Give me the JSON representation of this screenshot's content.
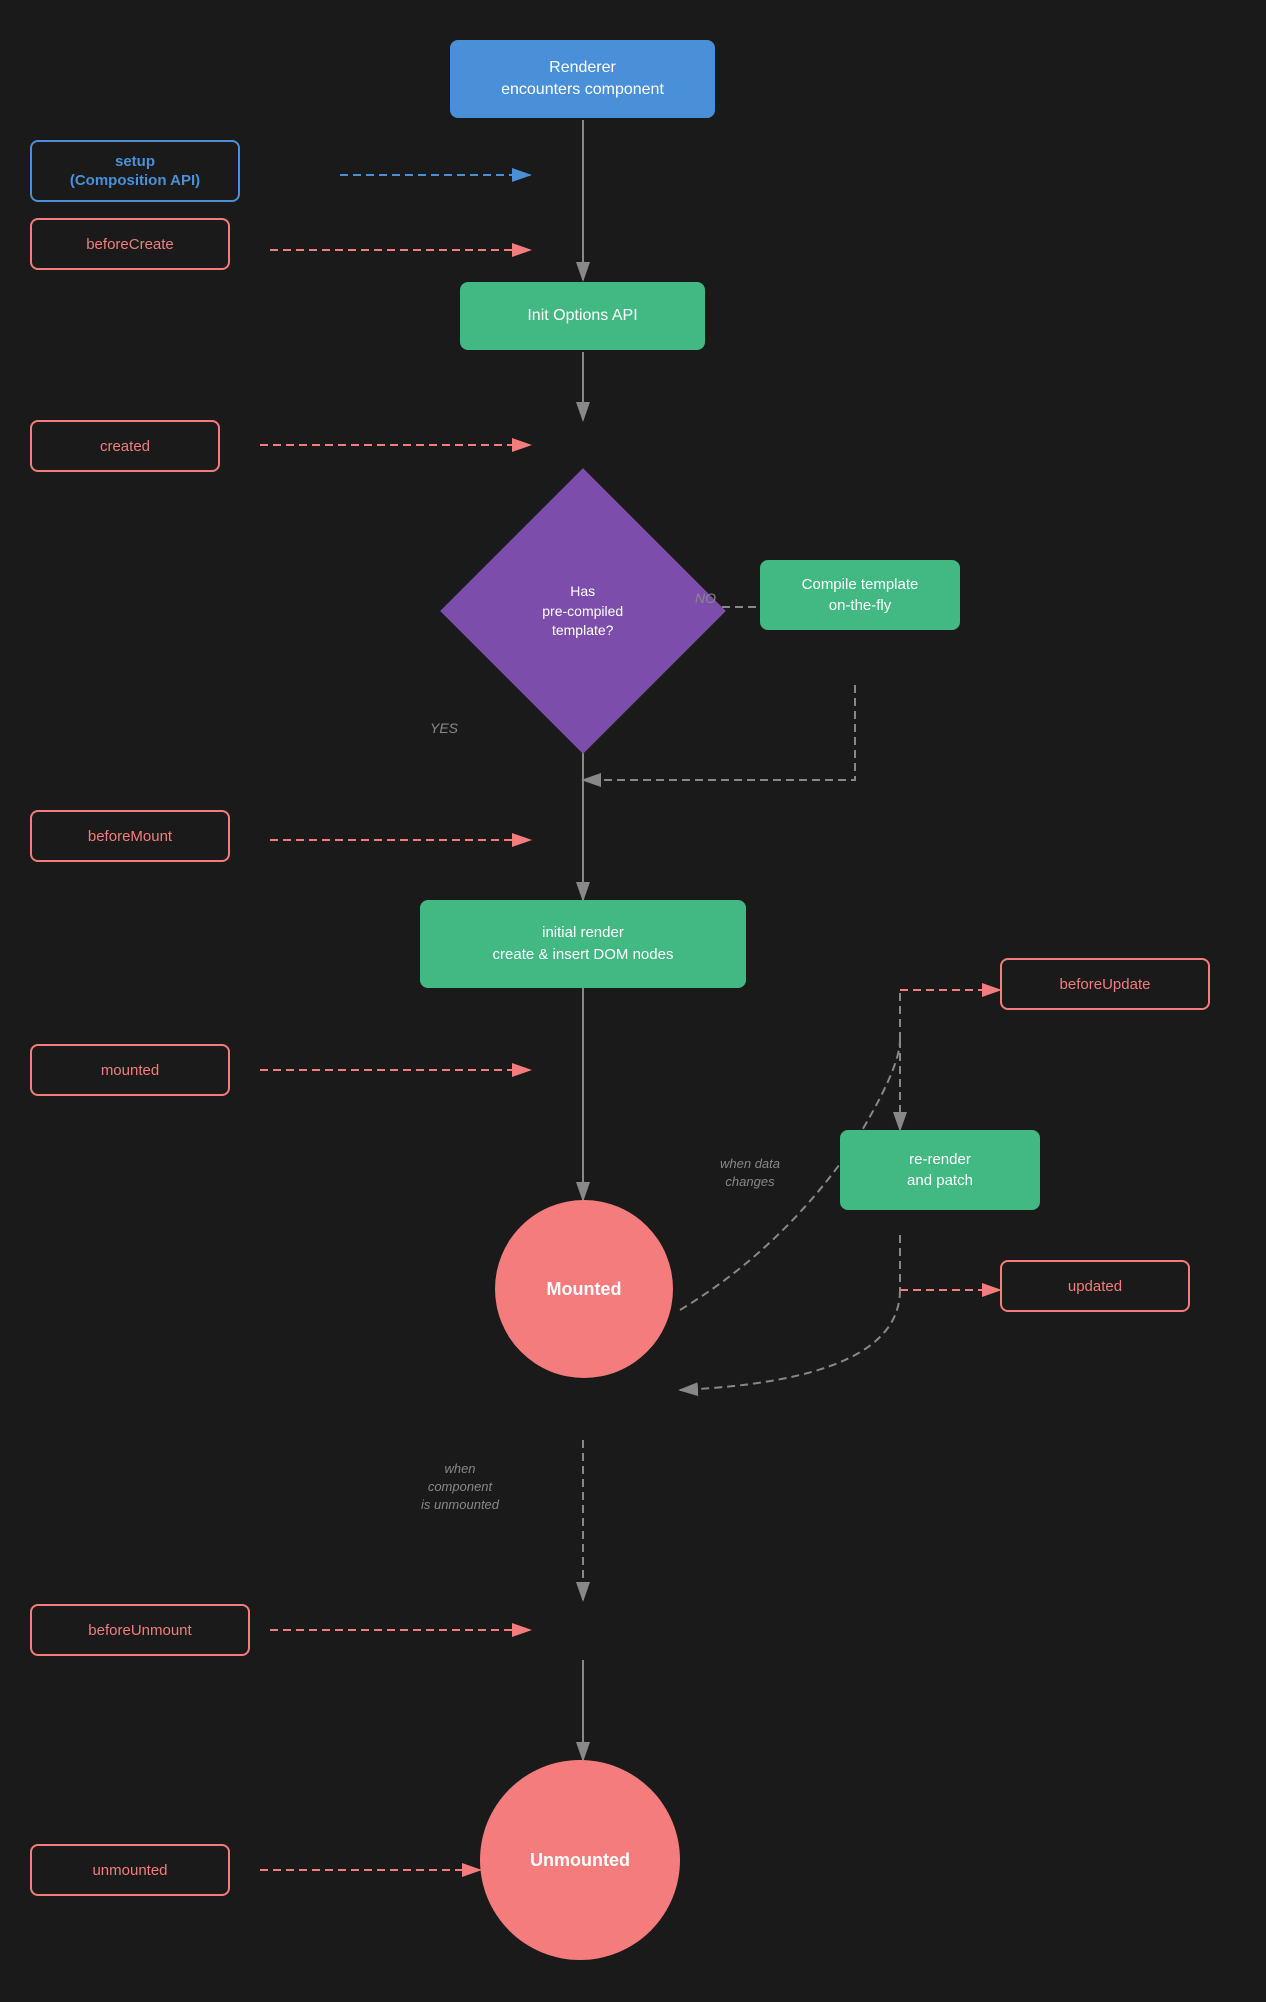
{
  "nodes": {
    "renderer": {
      "label": "Renderer\nencounters component"
    },
    "setup": {
      "label": "setup\n(Composition API)"
    },
    "beforeCreate": {
      "label": "beforeCreate"
    },
    "initOptions": {
      "label": "Init Options API"
    },
    "created": {
      "label": "created"
    },
    "hasTemplate": {
      "label": "Has\npre-compiled\ntemplate?"
    },
    "compileTemplate": {
      "label": "Compile template\non-the-fly"
    },
    "beforeMount": {
      "label": "beforeMount"
    },
    "initialRender": {
      "label": "initial render\ncreate & insert DOM nodes"
    },
    "beforeUpdate": {
      "label": "beforeUpdate"
    },
    "mounted": {
      "label": "mounted"
    },
    "mountedCircle": {
      "label": "Mounted"
    },
    "rerenderPatch": {
      "label": "re-render\nand patch"
    },
    "updated": {
      "label": "updated"
    },
    "beforeUnmount": {
      "label": "beforeUnmount"
    },
    "unmountedCircle": {
      "label": "Unmounted"
    },
    "unmounted": {
      "label": "unmounted"
    },
    "whenDataChanges": {
      "label": "when data\nchanges"
    },
    "whenUnmounted": {
      "label": "when\ncomponent\nis unmounted"
    },
    "yes": {
      "label": "YES"
    },
    "no": {
      "label": "NO"
    }
  }
}
